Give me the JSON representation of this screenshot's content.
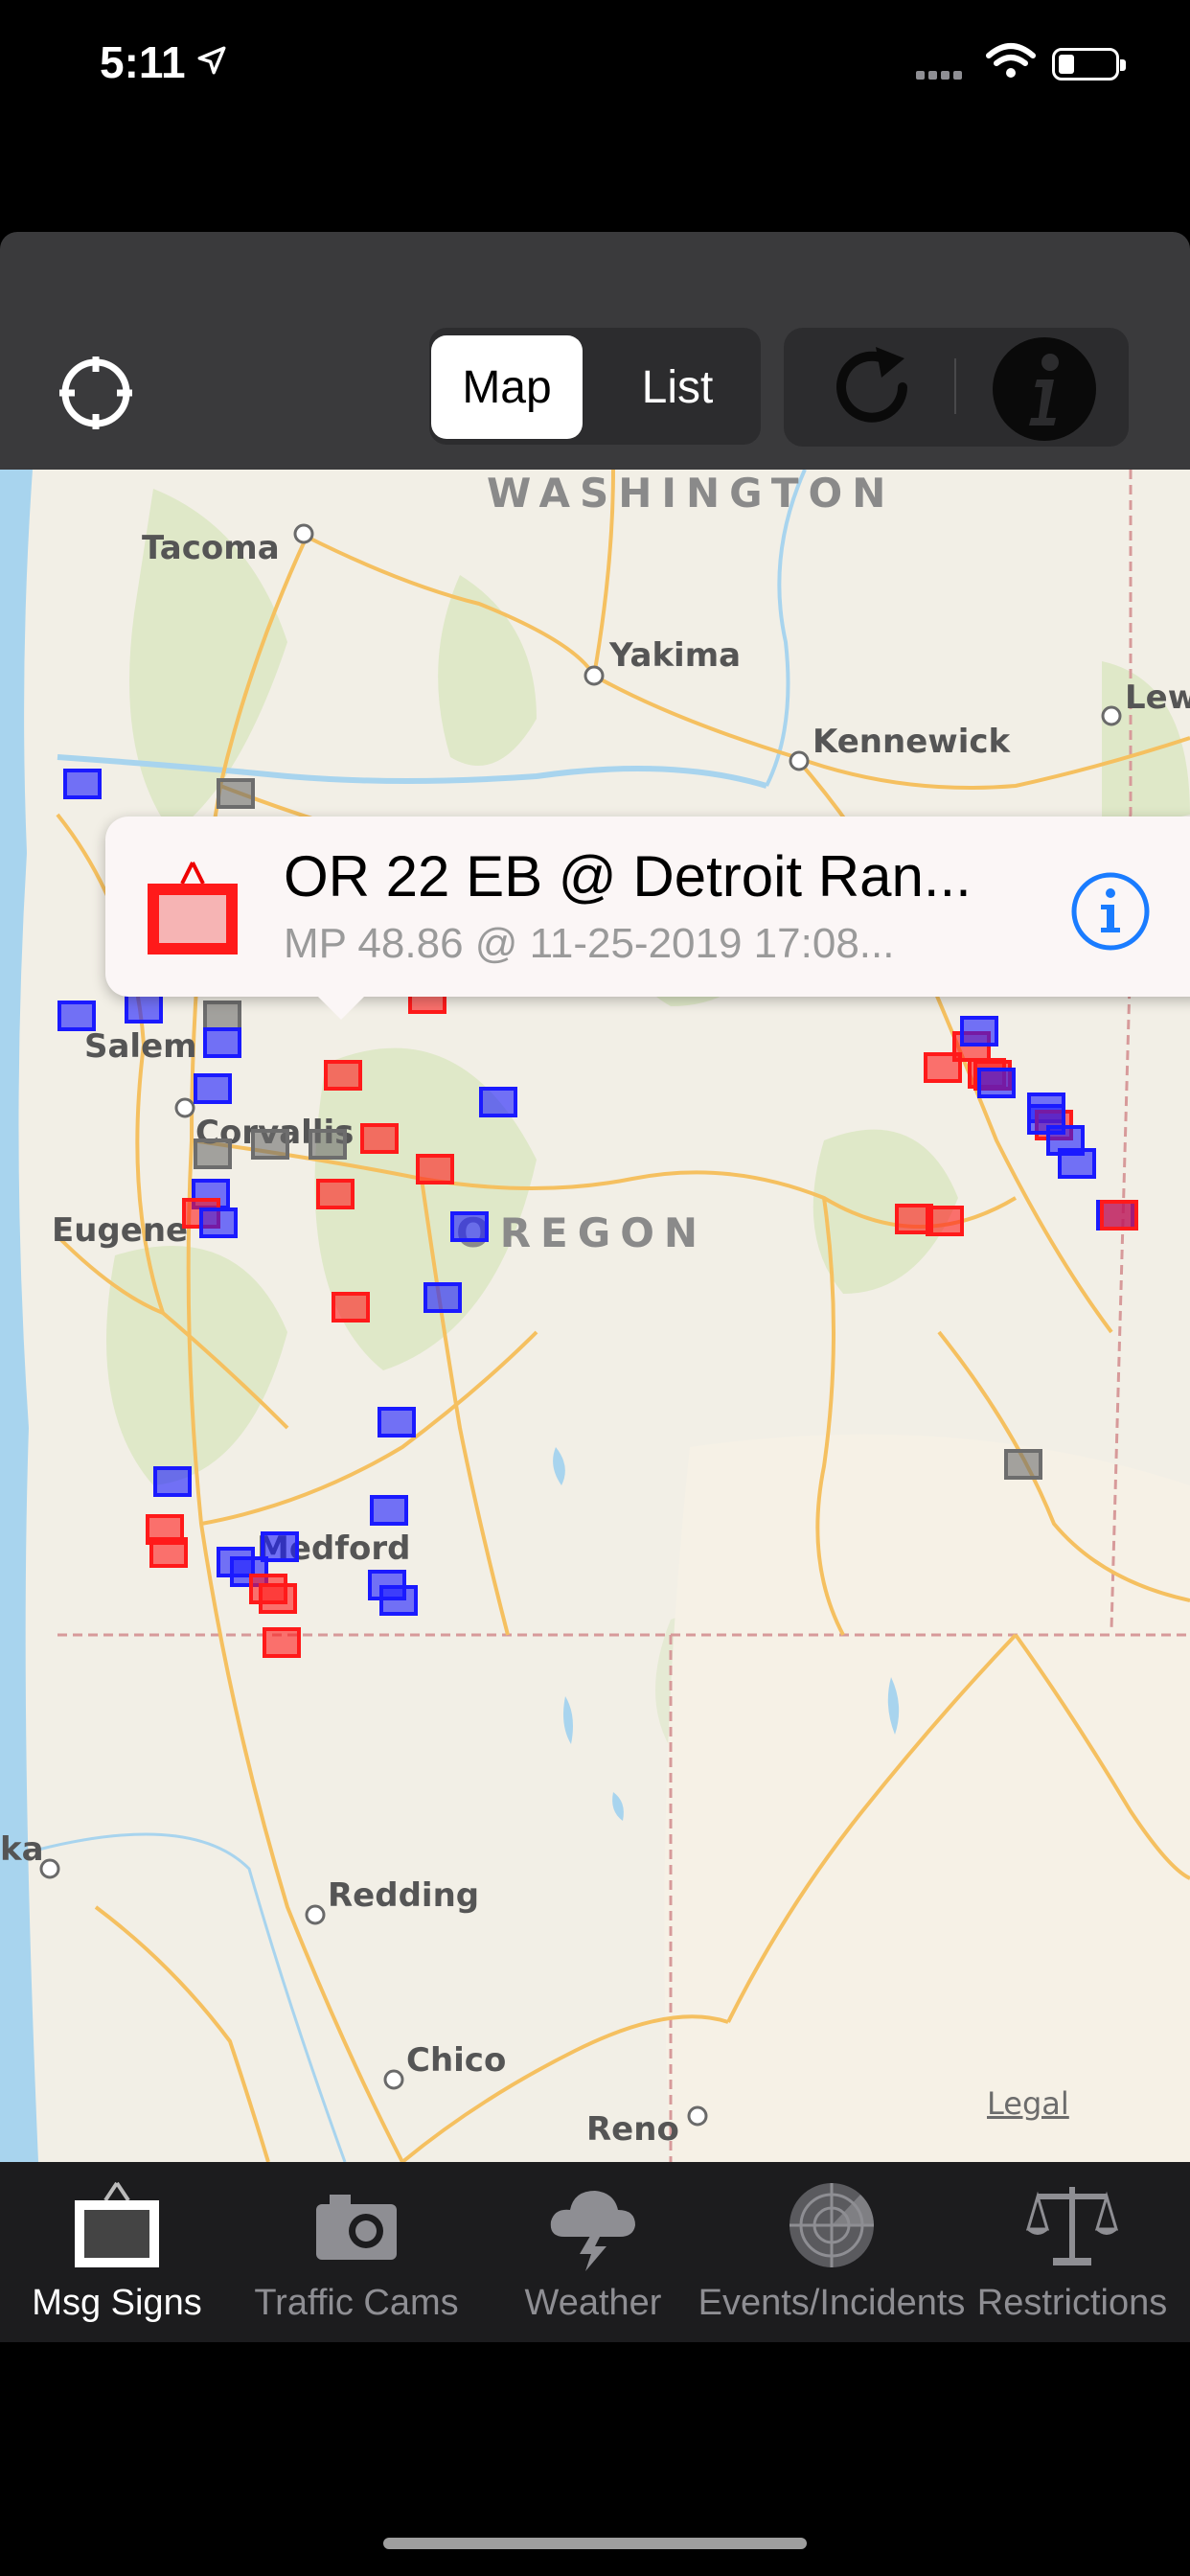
{
  "status_bar": {
    "time": "5:11"
  },
  "toolbar": {
    "segments": [
      {
        "label": "Map",
        "selected": true
      },
      {
        "label": "List",
        "selected": false
      }
    ]
  },
  "map": {
    "state_labels": [
      "WASHINGTON",
      "OREGON"
    ],
    "cities": [
      "Tacoma",
      "Yakima",
      "Kennewick",
      "Lew",
      "Salem",
      "Corvallis",
      "Eugene",
      "Medford",
      "ka",
      "Redding",
      "Chico",
      "Reno"
    ],
    "legal": "Legal",
    "marker_colors": {
      "red": "#ff1a1a",
      "blue": "#1a1aff",
      "gray": "#6d6d6d"
    }
  },
  "callout": {
    "title": "OR 22 EB @ Detroit Ran...",
    "subtitle": "MP 48.86 @ 11-25-2019 17:08..."
  },
  "tabbar": {
    "tabs": [
      {
        "label": "Msg Signs",
        "icon": "message-sign-icon",
        "active": true
      },
      {
        "label": "Traffic Cams",
        "icon": "camera-icon",
        "active": false
      },
      {
        "label": "Weather",
        "icon": "storm-cloud-icon",
        "active": false
      },
      {
        "label": "Events/Incidents",
        "icon": "radar-icon",
        "active": false
      },
      {
        "label": "Restrictions",
        "icon": "scales-icon",
        "active": false
      }
    ]
  }
}
